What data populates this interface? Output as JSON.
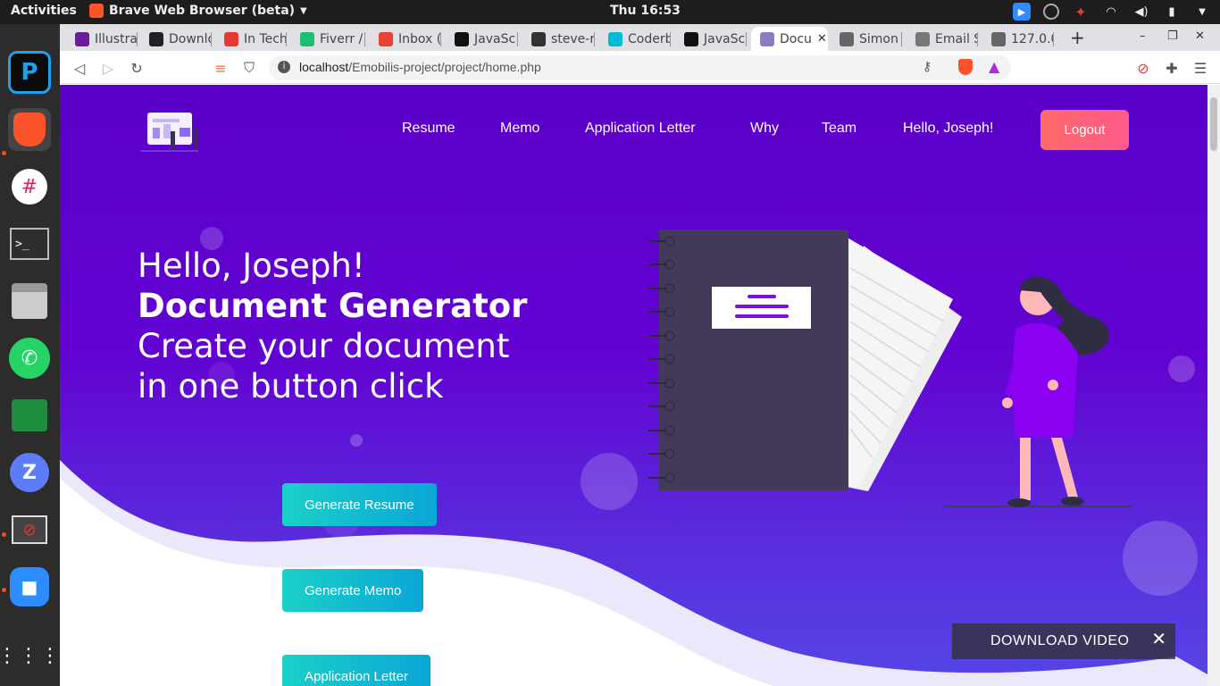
{
  "system": {
    "activities": "Activities",
    "app_name": "Brave Web Browser (beta)",
    "clock": "Thu 16:53"
  },
  "tabs": [
    {
      "title": "Illustra",
      "favicon_color": "#6a1b9a"
    },
    {
      "title": "Downlo",
      "favicon_color": "#222222"
    },
    {
      "title": "In Tech",
      "favicon_color": "#e53935"
    },
    {
      "title": "Fiverr /",
      "favicon_color": "#1dbf73"
    },
    {
      "title": "Inbox (",
      "favicon_color": "#ea4335"
    },
    {
      "title": "JavaSc",
      "favicon_color": "#111111"
    },
    {
      "title": "steve-r",
      "favicon_color": "#333333"
    },
    {
      "title": "Coderb",
      "favicon_color": "#00bcd4"
    },
    {
      "title": "JavaSc",
      "favicon_color": "#111111"
    },
    {
      "title": "Docu",
      "favicon_color": "#8e7cc3"
    },
    {
      "title": "Simon",
      "favicon_color": "#666666"
    },
    {
      "title": "Email S",
      "favicon_color": "#777777"
    },
    {
      "title": "127.0.0",
      "favicon_color": "#666666"
    }
  ],
  "address_bar": {
    "host": "localhost",
    "path": "/Emobilis-project/project/home.php"
  },
  "nav": {
    "links": [
      "Resume",
      "Memo",
      "Application Letter",
      "Why",
      "Team",
      "Hello, Joseph!"
    ],
    "logout": "Logout"
  },
  "hero": {
    "greeting": "Hello, Joseph!",
    "title": "Document Generator",
    "line1": "Create your document",
    "line2": "in one button click"
  },
  "buttons": {
    "resume": "Generate Resume",
    "memo": "Generate Memo",
    "letter": "Application Letter"
  },
  "toast": {
    "label": "DOWNLOAD VIDEO"
  },
  "colors": {
    "hero_bg": "#5a00c8",
    "accent_teal": "#1bd0c8",
    "logout": "#ff6a6a"
  }
}
